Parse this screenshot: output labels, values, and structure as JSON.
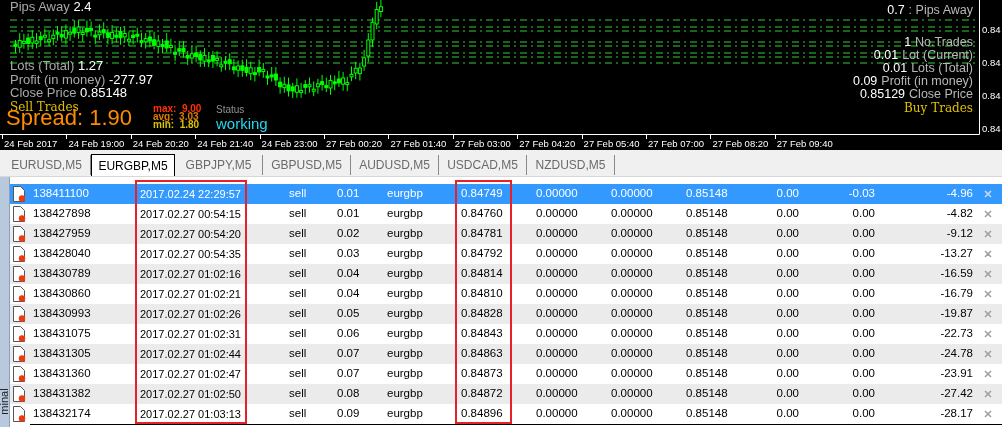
{
  "chart": {
    "left_panel": {
      "pips_away": {
        "label": "Pips Away",
        "value": "2.4"
      },
      "stats": [
        {
          "label": "Lots (Total)",
          "value": "1.27"
        },
        {
          "label": "Profit (in money)",
          "value": "-277.97"
        },
        {
          "label": "Close Price",
          "value": "0.85148"
        }
      ],
      "trades_label": "Sell Trades",
      "spread": "Spread: 1.90",
      "spread_stats": [
        {
          "label": "max:",
          "value": "9.00",
          "color": "#ff3300"
        },
        {
          "label": "avg:",
          "value": "3.03",
          "color": "#e07a00"
        },
        {
          "label": "min:",
          "value": "1.80",
          "color": "#d8c400"
        }
      ],
      "status_label": "Status",
      "status": "working"
    },
    "right_panel": {
      "pips_away": {
        "figure": "0.7",
        "caption": ": Pips Away"
      },
      "stats": [
        {
          "figure": "1",
          "caption": "No.Trades"
        },
        {
          "figure": "0.01",
          "caption": "Lot (Current)"
        },
        {
          "figure": "0.01",
          "caption": "Lots (Total)"
        },
        {
          "figure": "0.09",
          "caption": "Profit (in money)"
        },
        {
          "figure": "0.85129",
          "caption": "Close Price"
        }
      ],
      "trades_label": "Buy Trades"
    },
    "price_labels": [
      "0.84",
      "0.84",
      "0.84",
      "0.84"
    ],
    "time_labels": [
      "24 Feb 2017",
      "24 Feb 19:00",
      "24 Feb 20:20",
      "24 Feb 21:40",
      "24 Feb 23:00",
      "27 Feb 00:20",
      "27 Feb 01:40",
      "27 Feb 03:00",
      "27 Feb 04:20",
      "27 Feb 05:40",
      "27 Feb 07:00",
      "27 Feb 08:20",
      "27 Feb 09:40"
    ]
  },
  "tabs": [
    {
      "label": "EURUSD,M5",
      "selected": false
    },
    {
      "label": "EURGBP,M5",
      "selected": true
    },
    {
      "label": "GBPJPY,M5",
      "selected": false
    },
    {
      "label": "GBPUSD,M5",
      "selected": false
    },
    {
      "label": "AUDUSD,M5",
      "selected": false
    },
    {
      "label": "USDCAD,M5",
      "selected": false
    },
    {
      "label": "NZDUSD,M5",
      "selected": false
    }
  ],
  "terminal_label": "minal",
  "columns": [
    {
      "highlighted": false
    },
    {
      "highlighted": true
    },
    {
      "highlighted": false
    },
    {
      "highlighted": false
    },
    {
      "highlighted": false
    },
    {
      "highlighted": true
    },
    {
      "highlighted": false
    },
    {
      "highlighted": false
    },
    {
      "highlighted": false
    },
    {
      "highlighted": false
    },
    {
      "highlighted": false
    },
    {
      "highlighted": false
    }
  ],
  "rows": [
    {
      "selected": true,
      "cells": [
        "138411100",
        "2017.02.24 22:29:57",
        "sell",
        "0.01",
        "eurgbp",
        "0.84749",
        "0.00000",
        "0.00000",
        "0.85148",
        "0.00",
        "-0.03",
        "-4.96"
      ]
    },
    {
      "selected": false,
      "cells": [
        "138427898",
        "2017.02.27 00:54:15",
        "sell",
        "0.01",
        "eurgbp",
        "0.84760",
        "0.00000",
        "0.00000",
        "0.85148",
        "0.00",
        "0.00",
        "-4.82"
      ]
    },
    {
      "selected": false,
      "cells": [
        "138427959",
        "2017.02.27 00:54:20",
        "sell",
        "0.02",
        "eurgbp",
        "0.84781",
        "0.00000",
        "0.00000",
        "0.85148",
        "0.00",
        "0.00",
        "-9.12"
      ]
    },
    {
      "selected": false,
      "cells": [
        "138428040",
        "2017.02.27 00:54:35",
        "sell",
        "0.03",
        "eurgbp",
        "0.84792",
        "0.00000",
        "0.00000",
        "0.85148",
        "0.00",
        "0.00",
        "-13.27"
      ]
    },
    {
      "selected": false,
      "cells": [
        "138430789",
        "2017.02.27 01:02:16",
        "sell",
        "0.04",
        "eurgbp",
        "0.84814",
        "0.00000",
        "0.00000",
        "0.85148",
        "0.00",
        "0.00",
        "-16.59"
      ]
    },
    {
      "selected": false,
      "cells": [
        "138430860",
        "2017.02.27 01:02:21",
        "sell",
        "0.04",
        "eurgbp",
        "0.84810",
        "0.00000",
        "0.00000",
        "0.85148",
        "0.00",
        "0.00",
        "-16.79"
      ]
    },
    {
      "selected": false,
      "cells": [
        "138430993",
        "2017.02.27 01:02:26",
        "sell",
        "0.05",
        "eurgbp",
        "0.84828",
        "0.00000",
        "0.00000",
        "0.85148",
        "0.00",
        "0.00",
        "-19.87"
      ]
    },
    {
      "selected": false,
      "cells": [
        "138431075",
        "2017.02.27 01:02:31",
        "sell",
        "0.06",
        "eurgbp",
        "0.84843",
        "0.00000",
        "0.00000",
        "0.85148",
        "0.00",
        "0.00",
        "-22.73"
      ]
    },
    {
      "selected": false,
      "cells": [
        "138431305",
        "2017.02.27 01:02:44",
        "sell",
        "0.07",
        "eurgbp",
        "0.84863",
        "0.00000",
        "0.00000",
        "0.85148",
        "0.00",
        "0.00",
        "-24.78"
      ]
    },
    {
      "selected": false,
      "cells": [
        "138431360",
        "2017.02.27 01:02:47",
        "sell",
        "0.07",
        "eurgbp",
        "0.84873",
        "0.00000",
        "0.00000",
        "0.85148",
        "0.00",
        "0.00",
        "-23.91"
      ]
    },
    {
      "selected": false,
      "cells": [
        "138431382",
        "2017.02.27 01:02:50",
        "sell",
        "0.08",
        "eurgbp",
        "0.84872",
        "0.00000",
        "0.00000",
        "0.85148",
        "0.00",
        "0.00",
        "-27.42"
      ]
    },
    {
      "selected": false,
      "cells": [
        "138432174",
        "2017.02.27 01:03:13",
        "sell",
        "0.09",
        "eurgbp",
        "0.84896",
        "0.00000",
        "0.00000",
        "0.85148",
        "0.00",
        "0.00",
        "-28.17"
      ]
    }
  ]
}
